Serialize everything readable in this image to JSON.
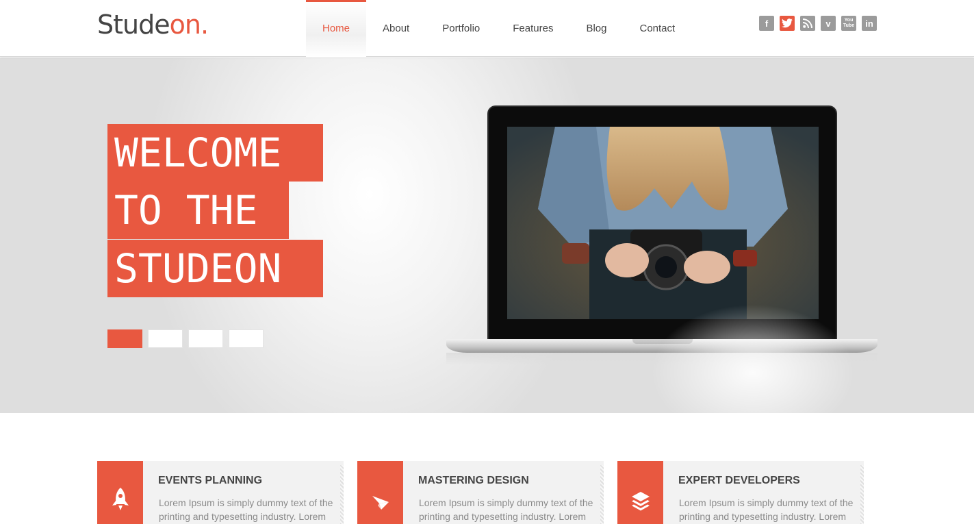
{
  "brand": {
    "logo_main": "Stude",
    "logo_accent": "on",
    "logo_dot": "."
  },
  "nav": {
    "items": [
      {
        "label": "Home",
        "active": true
      },
      {
        "label": "About"
      },
      {
        "label": "Portfolio"
      },
      {
        "label": "Features"
      },
      {
        "label": "Blog"
      },
      {
        "label": "Contact"
      }
    ]
  },
  "social": {
    "icons": [
      "facebook-icon",
      "twitter-icon",
      "rss-icon",
      "vimeo-icon",
      "youtube-icon",
      "linkedin-icon"
    ],
    "glyphs": {
      "facebook": "f",
      "vimeo": "v",
      "youtube_top": "You",
      "youtube_bottom": "Tube",
      "linkedin": "in"
    }
  },
  "hero": {
    "lines": [
      "WELCOME",
      "TO THE",
      "STUDEON"
    ],
    "slider_count": 4,
    "active_slide": 1
  },
  "features": [
    {
      "title": "EVENTS PLANNING",
      "text": "Lorem Ipsum is simply dummy text of the printing and typesetting industry. Lorem",
      "icon": "rocket-icon"
    },
    {
      "title": "MASTERING DESIGN",
      "text": "Lorem Ipsum is simply dummy text of the printing and typesetting industry. Lorem",
      "icon": "paper-plane-icon"
    },
    {
      "title": "EXPERT DEVELOPERS",
      "text": "Lorem Ipsum is simply dummy text of the printing and typesetting industry. Lorem",
      "icon": "layers-icon"
    }
  ],
  "colors": {
    "accent": "#e85840",
    "text": "#444444",
    "muted": "#8a8a8a"
  }
}
